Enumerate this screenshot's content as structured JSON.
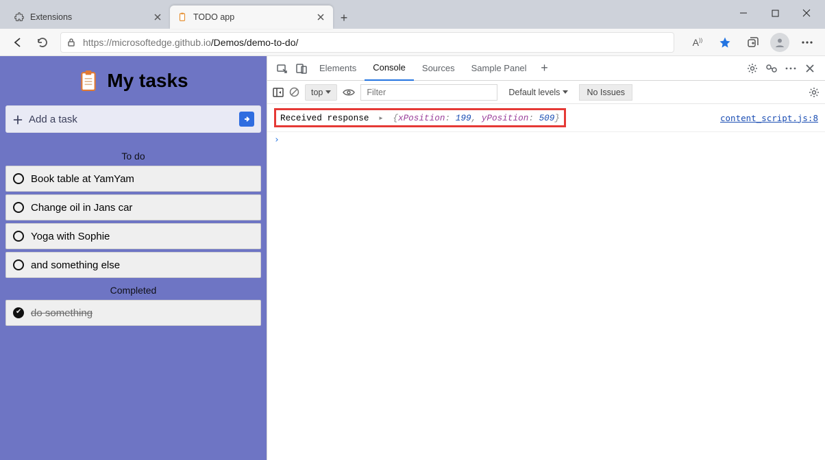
{
  "window": {
    "tabs": [
      {
        "title": "Extensions"
      },
      {
        "title": "TODO app"
      }
    ],
    "url_grey": "https://microsoftedge.github.io",
    "url_dark": "/Demos/demo-to-do/"
  },
  "todo": {
    "title": "My tasks",
    "add_placeholder": "Add a task",
    "sections": {
      "todo": "To do",
      "done": "Completed"
    },
    "tasks_open": [
      "Book table at YamYam",
      "Change oil in Jans car",
      "Yoga with Sophie",
      "and something else"
    ],
    "tasks_done": [
      "do something"
    ]
  },
  "devtools": {
    "tabs": [
      "Elements",
      "Console",
      "Sources",
      "Sample Panel"
    ],
    "active_tab": "Console",
    "filter": {
      "context": "top",
      "placeholder": "Filter",
      "levels": "Default levels",
      "issues": "No Issues"
    },
    "log": {
      "msg": "Received response",
      "obj_open": "{",
      "k1": "xPosition",
      "v1": "199",
      "sep": ", ",
      "k2": "yPosition",
      "v2": "509",
      "obj_close": "}",
      "source": "content_script.js:8"
    }
  }
}
